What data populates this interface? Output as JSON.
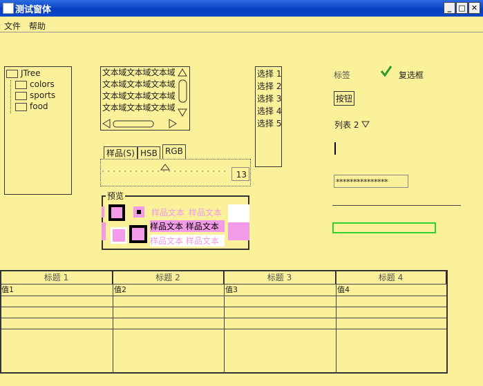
{
  "window": {
    "title": "测试窗体",
    "buttons": [
      "_",
      "□",
      "✕"
    ]
  },
  "menu": [
    "文件",
    "帮助"
  ],
  "tree": {
    "root": "JTree",
    "children": [
      "colors",
      "sports",
      "food"
    ]
  },
  "textarea": {
    "lines": [
      "文本域文本域文本域",
      "文本域文本域文本域",
      "文本域文本域文本域",
      "文本域文本域文本域"
    ]
  },
  "list": [
    "选择 1",
    "选择 2",
    "选择 3",
    "选择 4",
    "选择 5"
  ],
  "controls": {
    "label": "标签",
    "checkbox": "复选框",
    "button": "按钮",
    "combo": "列表 2",
    "password": "***************"
  },
  "colorchooser": {
    "tabs": [
      "样品(S)",
      "HSB",
      "RGB"
    ],
    "spinner_value": "13",
    "preview_title": "预览",
    "sample_text": "样品文本"
  },
  "table": {
    "headers": [
      "标题 1",
      "标题 2",
      "标题 3",
      "标题 4"
    ],
    "row1": [
      "值1",
      "值2",
      "值3",
      "值4"
    ]
  }
}
